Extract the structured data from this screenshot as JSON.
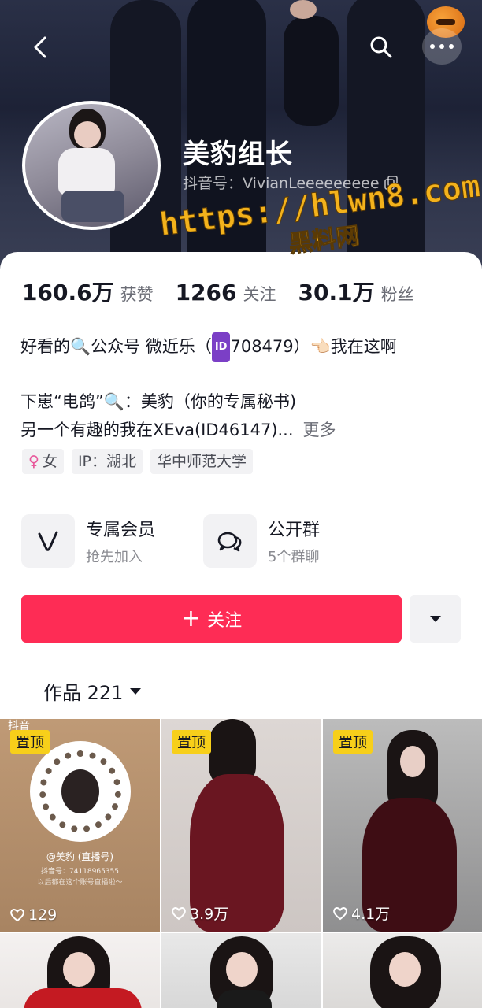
{
  "header": {
    "back_icon": "chevron-left-icon",
    "search_icon": "search-icon",
    "more_icon": "more-dots-icon"
  },
  "profile": {
    "name": "美豹组长",
    "handle": "抖音号：VivianLeeeeeeeee"
  },
  "watermark": {
    "url": "https://hlwn8.com",
    "sub": "黑料网"
  },
  "stats": [
    {
      "num": "160.6万",
      "label": "获赞"
    },
    {
      "num": "1266",
      "label": "关注"
    },
    {
      "num": "30.1万",
      "label": "粉丝"
    }
  ],
  "bio": {
    "line1_a": "好看的🔍公众号 微近乐（",
    "line1_id": "ID",
    "line1_b": "708479）👈🏻我在这啊",
    "line2": "下崽“电鸽”🔍：美豹（你的专属秘书)",
    "line3": "另一个有趣的我在XEva(ID46147)...",
    "more": "更多"
  },
  "tags": {
    "gender": "女",
    "gender_symbol": "♀",
    "ip": "IP：湖北",
    "school": "华中师范大学"
  },
  "features": [
    {
      "title": "专属会员",
      "subtitle": "抢先加入"
    },
    {
      "title": "公开群",
      "subtitle": "5个群聊"
    }
  ],
  "follow": {
    "label": "关注",
    "plus": "+"
  },
  "works": {
    "label": "作品 221"
  },
  "videos": [
    {
      "pinned": "置顶",
      "likes": "129"
    },
    {
      "pinned": "置顶",
      "likes": "3.9万"
    },
    {
      "pinned": "置顶",
      "likes": "4.1万"
    }
  ],
  "qr_card": {
    "brand": "抖音",
    "name": "@美豹 (直播号)",
    "id": "抖音号：74118965355",
    "note": "以后都在这个账号直播啦～"
  },
  "colors": {
    "accent": "#fe2c55",
    "pin_badge": "#f7cf1a"
  }
}
